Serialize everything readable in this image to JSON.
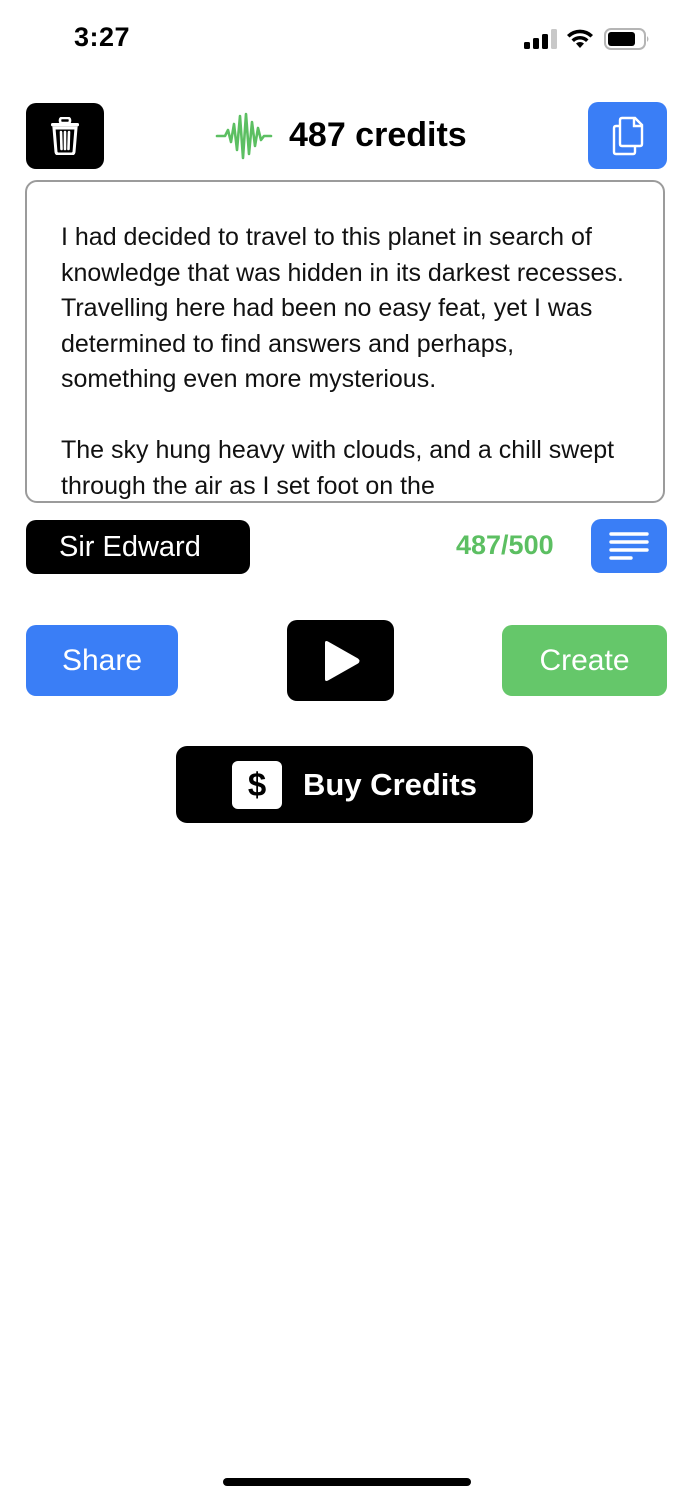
{
  "status_bar": {
    "time": "3:27"
  },
  "header": {
    "credits_title": "487 credits",
    "icons": {
      "left": "trash-icon",
      "center": "waveform-icon",
      "right": "copy-icon"
    }
  },
  "story": {
    "text": "I had decided to travel to this planet in search of knowledge that was hidden in its darkest recesses. Travelling here had been no easy feat, yet I was determined to find answers and perhaps, something even more mysterious.\n\nThe sky hung heavy with clouds, and a chill swept through the air as I set foot on the"
  },
  "voice": {
    "label": "Sir Edward",
    "char_count": "487/500"
  },
  "actions": {
    "share_label": "Share",
    "create_label": "Create",
    "play_icon": "play-icon"
  },
  "buy": {
    "label": "Buy Credits",
    "icon_symbol": "$"
  },
  "colors": {
    "blue": "#3a7ef6",
    "green": "#65c76a",
    "count_green": "#5cbf62",
    "black": "#000000"
  }
}
